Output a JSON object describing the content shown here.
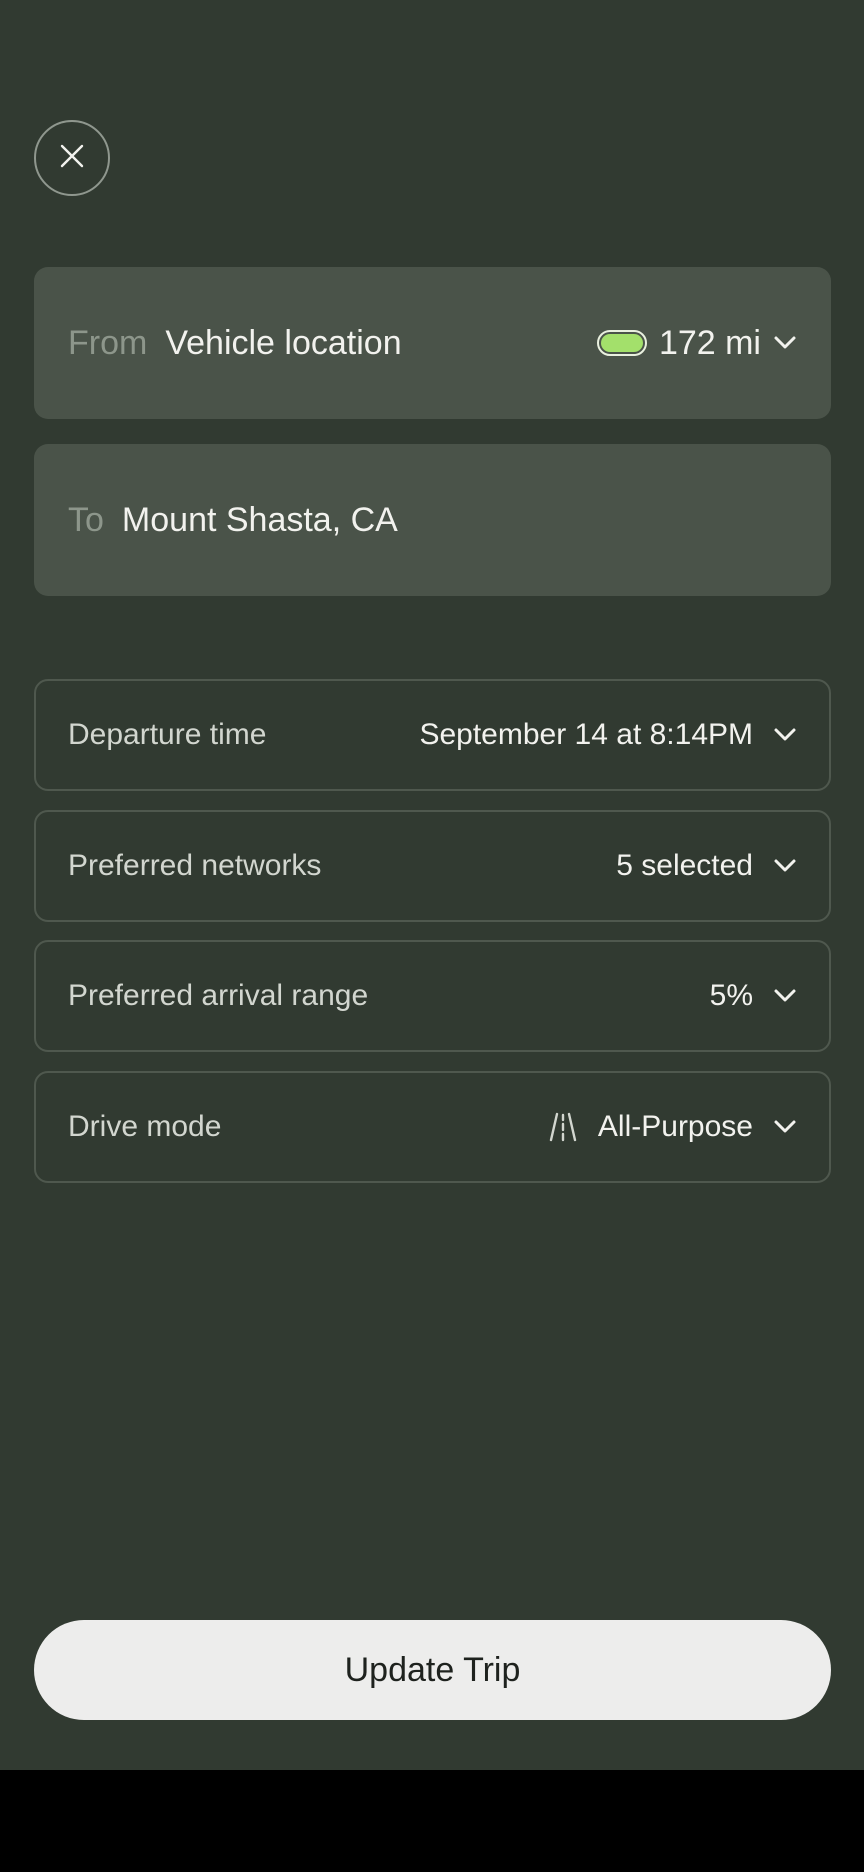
{
  "trip": {
    "from_label": "From",
    "from_value": "Vehicle location",
    "range": "172 mi",
    "to_label": "To",
    "to_value": "Mount Shasta, CA"
  },
  "options": [
    {
      "label": "Departure time",
      "value": "September 14 at 8:14PM"
    },
    {
      "label": "Preferred networks",
      "value": "5 selected"
    },
    {
      "label": "Preferred arrival range",
      "value": "5%"
    },
    {
      "label": "Drive mode",
      "value": "All-Purpose",
      "icon": "road-icon"
    }
  ],
  "actions": {
    "update_label": "Update Trip"
  },
  "icons": {
    "close": "close-icon",
    "battery": "battery-icon",
    "chevron": "chevron-down-icon"
  },
  "colors": {
    "background": "#313a31",
    "field": "#4a5349",
    "battery_fill": "#a3e06b",
    "button": "#ededec"
  }
}
